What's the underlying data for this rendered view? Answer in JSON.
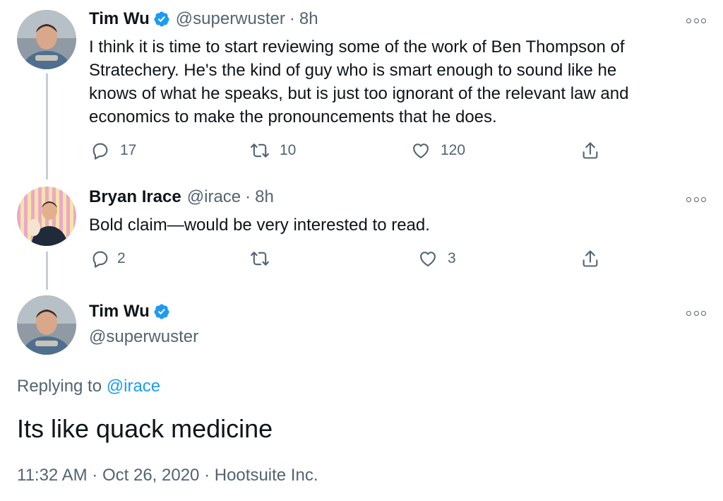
{
  "tweets": [
    {
      "name": "Tim Wu",
      "handle": "@superwuster",
      "separator": "·",
      "time": "8h",
      "lines": [
        "I think it is time to start reviewing some of the work of Ben Thompson of",
        "Stratechery. He's the kind of guy who is smart enough to sound like he",
        "knows of what he speaks, but is just too ignorant of the relevant law and",
        "economics to make the pronouncements that he does."
      ],
      "replies": "17",
      "retweets": "10",
      "likes": "120"
    },
    {
      "name": "Bryan Irace",
      "handle": "@irace",
      "separator": "·",
      "time": "8h",
      "text": "Bold claim—would be very interested to read.",
      "replies": "2",
      "retweets": "",
      "likes": "3"
    }
  ],
  "focus": {
    "name": "Tim Wu",
    "handle": "@superwuster",
    "replying_prefix": "Replying to",
    "replying_to": "@irace",
    "text": "Its like quack medicine",
    "timestamp": "11:32 AM",
    "date": "Oct 26, 2020",
    "source": "Hootsuite Inc.",
    "separator": "·"
  },
  "icons": {
    "verified": "verified-badge-icon",
    "reply": "reply-icon",
    "retweet": "retweet-icon",
    "like": "heart-icon",
    "share": "share-icon",
    "more": "more-options-icon"
  },
  "colors": {
    "verified": "#1d9bf0",
    "mention": "#1d9bf0",
    "secondary_text": "#536471",
    "primary_text": "#0f1419",
    "thread_line": "#c4cfd6"
  }
}
